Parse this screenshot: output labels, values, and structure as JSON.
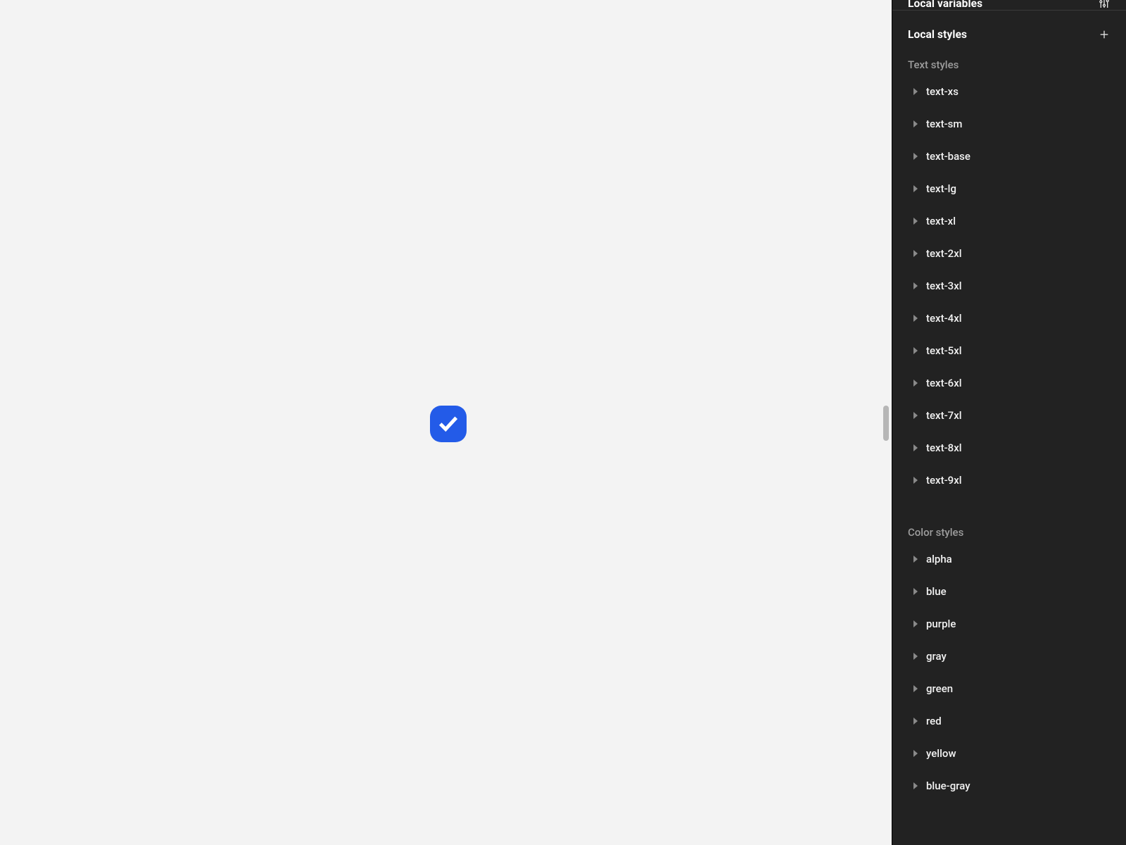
{
  "panel": {
    "local_variables_header": "Local variables",
    "local_styles_header": "Local styles",
    "text_styles_label": "Text styles",
    "color_styles_label": "Color styles",
    "text_styles": [
      "text-xs",
      "text-sm",
      "text-base",
      "text-lg",
      "text-xl",
      "text-2xl",
      "text-3xl",
      "text-4xl",
      "text-5xl",
      "text-6xl",
      "text-7xl",
      "text-8xl",
      "text-9xl"
    ],
    "color_styles": [
      "alpha",
      "blue",
      "purple",
      "gray",
      "green",
      "red",
      "yellow",
      "blue-gray"
    ],
    "icons": {
      "variables": "settings-sliders-icon",
      "add_style": "plus-icon"
    }
  },
  "canvas": {
    "badge_color": "#235be8",
    "badge_icon": "checkmark-icon"
  }
}
